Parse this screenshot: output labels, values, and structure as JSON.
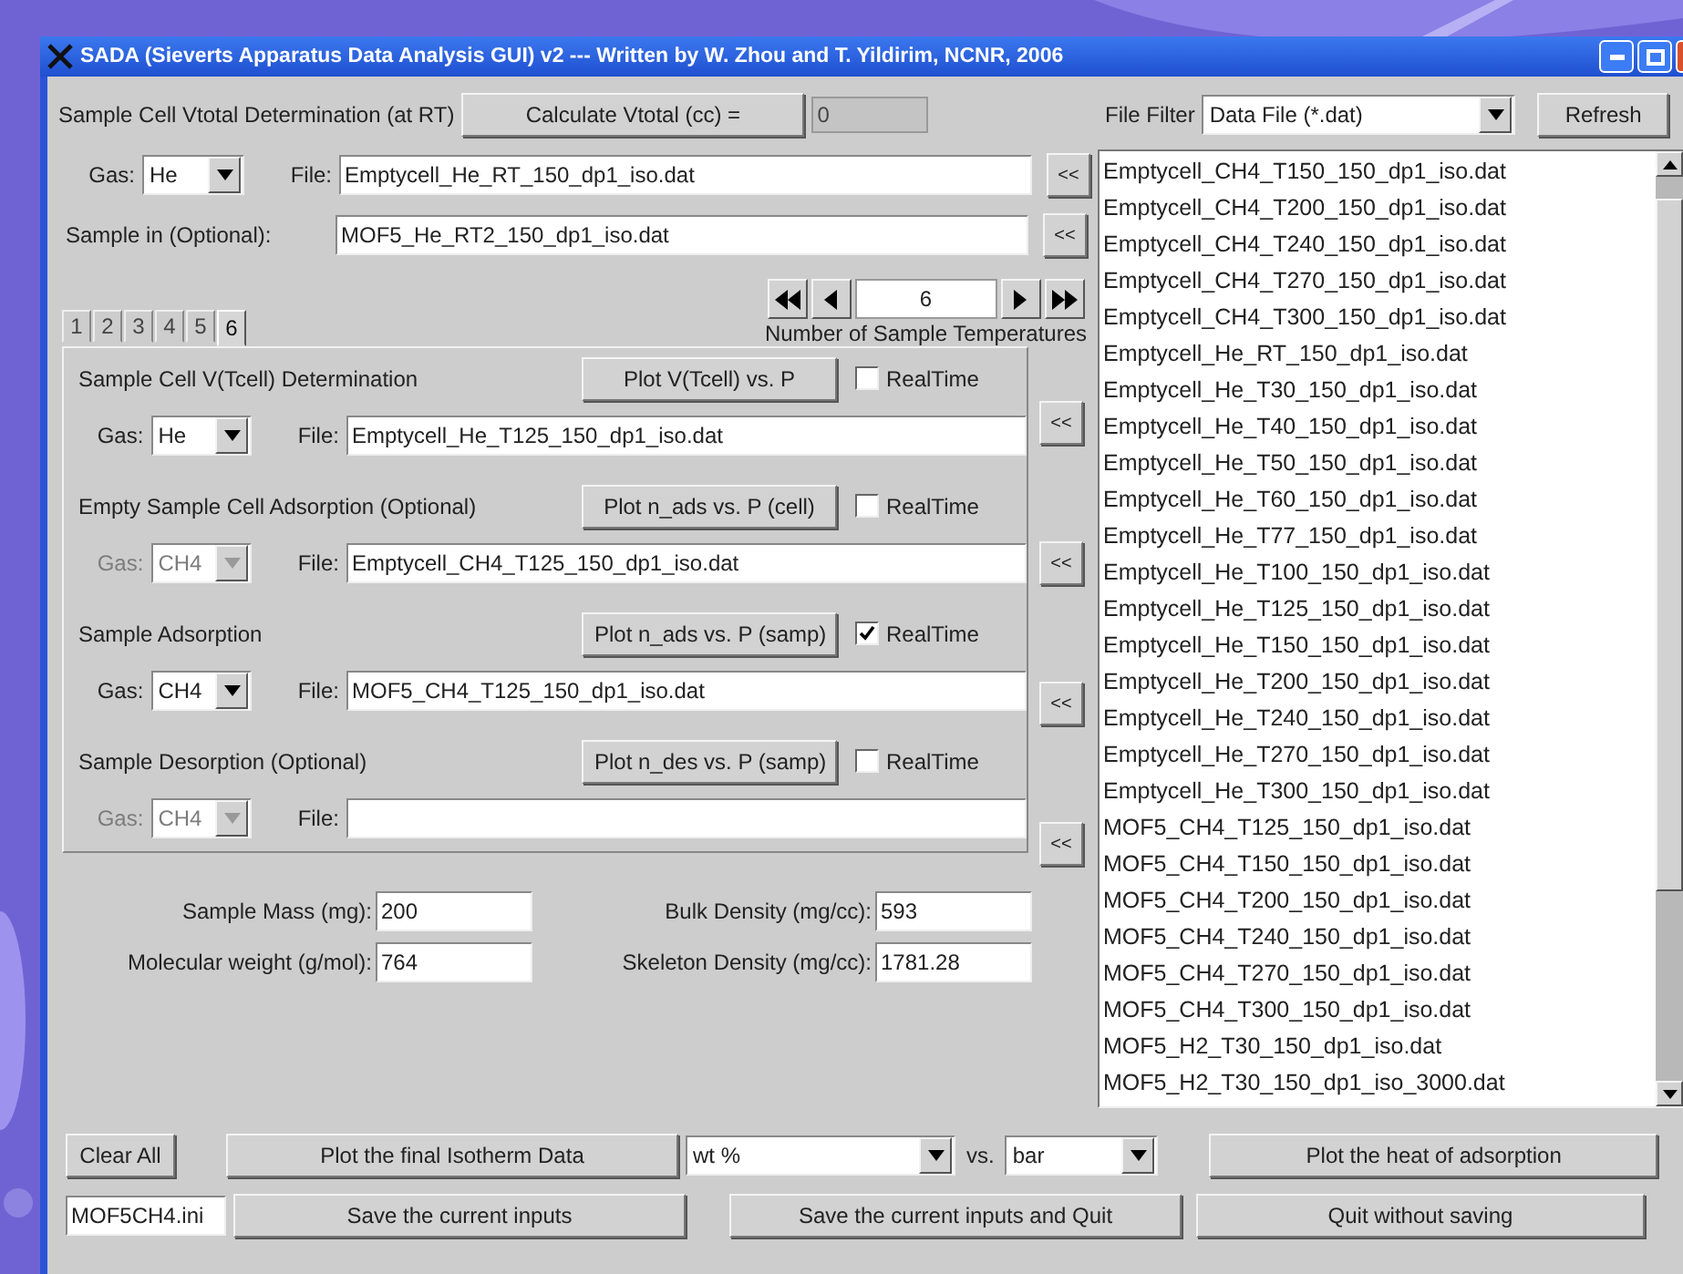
{
  "window": {
    "title": "SADA (Sieverts Apparatus Data Analysis GUI) v2 --- Written by W. Zhou and T. Yildirim, NCNR, 2006"
  },
  "vtotal": {
    "label": "Sample Cell Vtotal Determination (at RT)",
    "button": "Calculate Vtotal (cc) =",
    "value": "0"
  },
  "empty_cell": {
    "gas_label": "Gas:",
    "gas": "He",
    "file_label": "File:",
    "file": "Emptycell_He_RT_150_dp1_iso.dat",
    "arrow": "<<"
  },
  "sample_in": {
    "label": "Sample in  (Optional):",
    "file": "MOF5_He_RT2_150_dp1_iso.dat",
    "arrow": "<<"
  },
  "temperatures": {
    "value": "6",
    "label": "Number of Sample Temperatures"
  },
  "tabs": [
    {
      "label": "1",
      "selected": false
    },
    {
      "label": "2",
      "selected": false
    },
    {
      "label": "3",
      "selected": false
    },
    {
      "label": "4",
      "selected": false
    },
    {
      "label": "5",
      "selected": false
    },
    {
      "label": "6",
      "selected": true
    }
  ],
  "sections": [
    {
      "title": "Sample Cell V(Tcell) Determination",
      "button": "Plot V(Tcell) vs. P",
      "realtime": {
        "label": "RealTime",
        "checked": false
      },
      "gas_label": "Gas:",
      "gas": "He",
      "gas_disabled": false,
      "file_label": "File:",
      "file": "Emptycell_He_T125_150_dp1_iso.dat",
      "arrow": "<<"
    },
    {
      "title": "Empty Sample Cell Adsorption (Optional)",
      "button": "Plot n_ads vs. P (cell)",
      "realtime": {
        "label": "RealTime",
        "checked": false
      },
      "gas_label": "Gas:",
      "gas": "CH4",
      "gas_disabled": true,
      "file_label": "File:",
      "file": "Emptycell_CH4_T125_150_dp1_iso.dat",
      "arrow": "<<"
    },
    {
      "title": "Sample Adsorption",
      "button": "Plot n_ads vs. P (samp)",
      "realtime": {
        "label": "RealTime",
        "checked": true
      },
      "gas_label": "Gas:",
      "gas": "CH4",
      "gas_disabled": false,
      "file_label": "File:",
      "file": "MOF5_CH4_T125_150_dp1_iso.dat",
      "arrow": "<<"
    },
    {
      "title": "Sample Desorption (Optional)",
      "button": "Plot n_des vs. P (samp)",
      "realtime": {
        "label": "RealTime",
        "checked": false
      },
      "gas_label": "Gas:",
      "gas": "CH4",
      "gas_disabled": true,
      "file_label": "File:",
      "arrow": "<<"
    }
  ],
  "properties": [
    {
      "label": "Sample Mass (mg):",
      "value": "200"
    },
    {
      "label": "Bulk Density (mg/cc):",
      "value": "593"
    },
    {
      "label": "Molecular weight (g/mol):",
      "value": "764"
    },
    {
      "label": "Skeleton Density (mg/cc):",
      "value": "1781.28"
    }
  ],
  "file_filter": {
    "label": "File Filter",
    "value": "Data File (*.dat)",
    "button": "Refresh"
  },
  "files": [
    "Emptycell_CH4_T150_150_dp1_iso.dat",
    "Emptycell_CH4_T200_150_dp1_iso.dat",
    "Emptycell_CH4_T240_150_dp1_iso.dat",
    "Emptycell_CH4_T270_150_dp1_iso.dat",
    "Emptycell_CH4_T300_150_dp1_iso.dat",
    "Emptycell_He_RT_150_dp1_iso.dat",
    "Emptycell_He_T30_150_dp1_iso.dat",
    "Emptycell_He_T40_150_dp1_iso.dat",
    "Emptycell_He_T50_150_dp1_iso.dat",
    "Emptycell_He_T60_150_dp1_iso.dat",
    "Emptycell_He_T77_150_dp1_iso.dat",
    "Emptycell_He_T100_150_dp1_iso.dat",
    "Emptycell_He_T125_150_dp1_iso.dat",
    "Emptycell_He_T150_150_dp1_iso.dat",
    "Emptycell_He_T200_150_dp1_iso.dat",
    "Emptycell_He_T240_150_dp1_iso.dat",
    "Emptycell_He_T270_150_dp1_iso.dat",
    "Emptycell_He_T300_150_dp1_iso.dat",
    "MOF5_CH4_T125_150_dp1_iso.dat",
    "MOF5_CH4_T150_150_dp1_iso.dat",
    "MOF5_CH4_T200_150_dp1_iso.dat",
    "MOF5_CH4_T240_150_dp1_iso.dat",
    "MOF5_CH4_T270_150_dp1_iso.dat",
    "MOF5_CH4_T300_150_dp1_iso.dat",
    "MOF5_H2_T30_150_dp1_iso.dat",
    "MOF5_H2_T30_150_dp1_iso_3000.dat"
  ],
  "bottom": {
    "clear": "Clear All",
    "plot_isotherm": "Plot the final Isotherm Data",
    "unit_y": "wt %",
    "vs": "vs.",
    "unit_x": "bar",
    "plot_heat": "Plot the heat of adsorption",
    "ini_file": "MOF5CH4.ini",
    "save": "Save the current inputs",
    "save_quit": "Save the current inputs and Quit",
    "quit": "Quit without saving"
  }
}
